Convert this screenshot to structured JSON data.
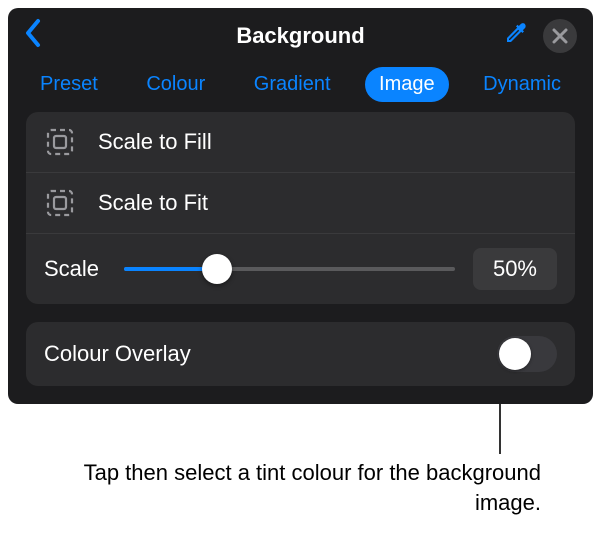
{
  "header": {
    "title": "Background"
  },
  "tabs": {
    "items": [
      "Preset",
      "Colour",
      "Gradient",
      "Image",
      "Dynamic"
    ],
    "selected_index": 3
  },
  "scale_options": {
    "fill_label": "Scale to Fill",
    "fit_label": "Scale to Fit"
  },
  "scale_slider": {
    "label": "Scale",
    "value_display": "50%"
  },
  "overlay": {
    "label": "Colour Overlay",
    "on": false
  },
  "callout": {
    "text": "Tap then select a tint colour for the background image."
  }
}
